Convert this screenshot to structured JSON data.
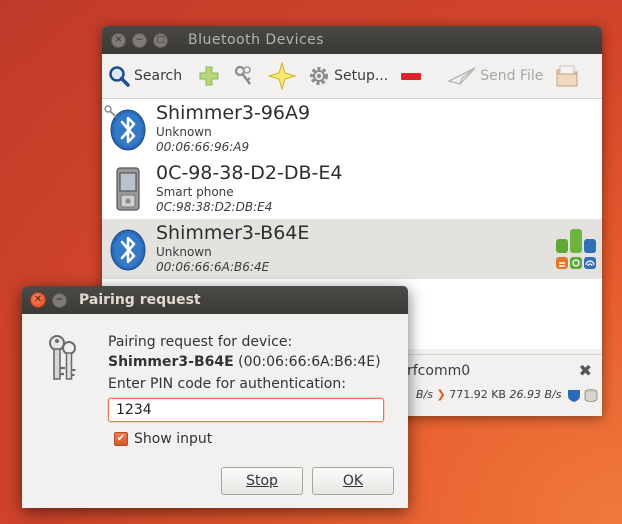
{
  "main_window": {
    "title": "Bluetooth Devices",
    "toolbar": {
      "search_label": "Search",
      "setup_label": "Setup...",
      "send_file_label": "Send File"
    },
    "devices": [
      {
        "name": "Shimmer3-96A9",
        "type": "Unknown",
        "address": "00:06:66:96:A9",
        "icon": "bluetooth-icon"
      },
      {
        "name": "0C-98-38-D2-DB-E4",
        "type": "Smart phone",
        "address": "0C:98:38:D2:DB:E4",
        "icon": "phone-icon"
      },
      {
        "name": "Shimmer3-B64E",
        "type": "Unknown",
        "address": "00:06:66:6A:B6:4E",
        "icon": "bluetooth-icon"
      }
    ],
    "status": {
      "path": "v/rfcomm0",
      "speed_down_unit": "B/s",
      "transferred": "771.92 KB",
      "speed_up": "26.93 B/s"
    }
  },
  "dialog": {
    "title": "Pairing request",
    "line1": "Pairing request for device:",
    "device_name": "Shimmer3-B64E",
    "device_address": "(00:06:66:6A:B6:4E)",
    "line3": "Enter PIN code for authentication:",
    "pin_value": "1234",
    "show_input_label": "Show input",
    "stop_label": "Stop",
    "ok_label": "OK"
  },
  "colors": {
    "accent": "#e57a4f",
    "titlebar": "#3c3b37",
    "bluetooth_blue": "#2a6ab8"
  }
}
